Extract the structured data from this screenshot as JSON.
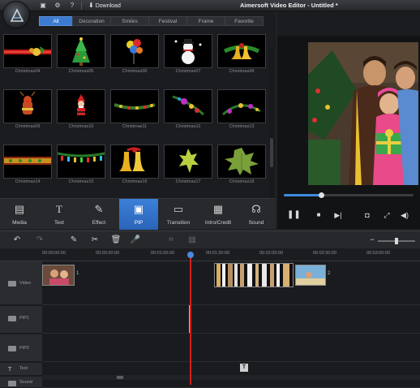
{
  "app": {
    "title": "Aimersoft Video Editor - Untitled *",
    "download_label": "Download"
  },
  "titlebar_icons": [
    "window-icon",
    "settings-icon",
    "help-icon"
  ],
  "library": {
    "categories": [
      {
        "label": "All",
        "active": true
      },
      {
        "label": "Decoration",
        "active": false
      },
      {
        "label": "Smiles",
        "active": false
      },
      {
        "label": "Festival",
        "active": false
      },
      {
        "label": "Frame",
        "active": false
      },
      {
        "label": "Favorite",
        "active": false
      }
    ],
    "items": [
      {
        "label": "Christmas04",
        "art": "ribbon"
      },
      {
        "label": "Christmas05",
        "art": "tree"
      },
      {
        "label": "Christmas06",
        "art": "balloons"
      },
      {
        "label": "Christmas07",
        "art": "snowman"
      },
      {
        "label": "Christmas08",
        "art": "bells"
      },
      {
        "label": "Christmas09",
        "art": "reindeer"
      },
      {
        "label": "Christmas10",
        "art": "santa"
      },
      {
        "label": "Christmas11",
        "art": "garland"
      },
      {
        "label": "Christmas12",
        "art": "ornaments"
      },
      {
        "label": "Christmas13",
        "art": "ornaments2"
      },
      {
        "label": "Christmas14",
        "art": "border"
      },
      {
        "label": "Christmas15",
        "art": "lights"
      },
      {
        "label": "Christmas16",
        "art": "bells2"
      },
      {
        "label": "Christmas17",
        "art": "leaf"
      },
      {
        "label": "Christmas18",
        "art": "leaf2"
      }
    ]
  },
  "toolbar": {
    "buttons": [
      {
        "label": "Media",
        "icon": "media-icon",
        "active": false
      },
      {
        "label": "Text",
        "icon": "text-icon",
        "active": false
      },
      {
        "label": "Effect",
        "icon": "effect-icon",
        "active": false
      },
      {
        "label": "PIP",
        "icon": "pip-icon",
        "active": true
      },
      {
        "label": "Transition",
        "icon": "transition-icon",
        "active": false
      },
      {
        "label": "Intro/Credit",
        "icon": "intro-credit-icon",
        "active": false
      },
      {
        "label": "Sound",
        "icon": "sound-icon",
        "active": false
      }
    ]
  },
  "preview": {
    "progress": 0.29
  },
  "timeline": {
    "zoom_level": 0.5,
    "ruler_ticks": [
      "00:00:00:00",
      "00:00:30:00",
      "00:01:00:00",
      "00:01:30:00",
      "00:02:00:00",
      "00:02:30:00",
      "00:03:00:00"
    ],
    "tracks": [
      {
        "label": "Video",
        "icon": "video-track-icon"
      },
      {
        "label": "PIP1",
        "icon": "pip-track-icon"
      },
      {
        "label": "PIP2",
        "icon": "pip-track-icon"
      },
      {
        "label": "Text",
        "icon": "text-track-icon"
      },
      {
        "label": "Sound",
        "icon": "sound-track-icon"
      }
    ],
    "clip_numbers": [
      "1",
      "2"
    ],
    "text_marker": "T"
  },
  "colors": {
    "accent": "#3d7bd1",
    "playhead": "#d32020",
    "background": "#202225"
  }
}
